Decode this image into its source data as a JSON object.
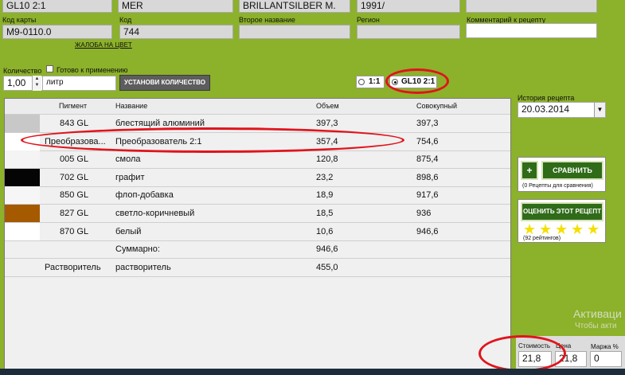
{
  "top_row": {
    "code": "GL10 2:1",
    "brand": "MER",
    "name": "BRILLANTSILBER M.",
    "year": "1991/"
  },
  "labels": {
    "card_code": "Код карты",
    "code": "Код",
    "second_name": "Второе название",
    "region": "Регион",
    "comment": "Комментарий к рецепту",
    "quantity": "Количество",
    "ready": "Готово к применению"
  },
  "fields": {
    "card_code": "M9-0110.0",
    "code": "744",
    "second_name": "",
    "region": "",
    "comment": "",
    "quantity": "1,00",
    "unit": "литр"
  },
  "links": {
    "color_complaint": "ЖАЛОБА НА ЦВЕТ"
  },
  "buttons": {
    "set_quantity": "УСТАНОВИ КОЛИЧЕСТВО",
    "plus": "+",
    "compare": "СРАВНИТЬ",
    "rate": "ОЦЕНИТЬ ЭТОТ РЕЦЕПТ"
  },
  "ratio_options": [
    "1:1",
    "GL10 2:1"
  ],
  "table": {
    "columns": [
      "Пигмент",
      "Название",
      "Объем",
      "Совокупный"
    ],
    "rows": [
      {
        "color": "#c8c8c8",
        "pigment": "843 GL",
        "name": "блестящий алюминий",
        "volume": "397,3",
        "cumulative": "397,3"
      },
      {
        "color": "#ffffff",
        "pigment": "Преобразова...",
        "name": "Преобразователь 2:1",
        "volume": "357,4",
        "cumulative": "754,6"
      },
      {
        "color": "#f4f4f4",
        "pigment": "005 GL",
        "name": "смола",
        "volume": "120,8",
        "cumulative": "875,4"
      },
      {
        "color": "#050505",
        "pigment": "702 GL",
        "name": "графит",
        "volume": "23,2",
        "cumulative": "898,6"
      },
      {
        "color": "#f6f6f6",
        "pigment": "850 GL",
        "name": "флоп-добавка",
        "volume": "18,9",
        "cumulative": "917,6"
      },
      {
        "color": "#a55a00",
        "pigment": "827 GL",
        "name": "светло-коричневый",
        "volume": "18,5",
        "cumulative": "936"
      },
      {
        "color": "#ffffff",
        "pigment": "870 GL",
        "name": "белый",
        "volume": "10,6",
        "cumulative": "946,6"
      }
    ],
    "summary": {
      "label": "Суммарно:",
      "volume": "946,6"
    },
    "solvent": {
      "pigment": "Растворитель",
      "name": "растворитель",
      "volume": "455,0"
    }
  },
  "history": {
    "label": "История рецепта",
    "date": "20.03.2014"
  },
  "compare": {
    "note": "(0 Рецепты для сравнения)"
  },
  "rating": {
    "stars": 5,
    "count_text": "(92 рейтингов)"
  },
  "cost": {
    "cost_label": "Стоимость",
    "price_label": "Цена",
    "margin_label": "Маржа %",
    "cost_value": "21,8",
    "price_value": "21,8",
    "margin_value": "0"
  },
  "watermark": {
    "line1": "Активаци",
    "line2": "Чтобы акти"
  },
  "colors": {
    "background": "#8cb12a",
    "highlight_oval": "#e0141c",
    "button_green": "#2f6b18"
  }
}
